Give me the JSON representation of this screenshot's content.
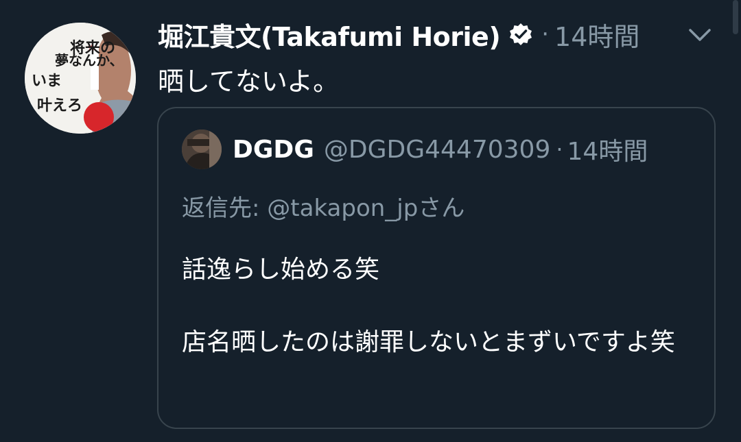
{
  "tweet": {
    "author_name": "堀江貴文(Takafumi Horie)",
    "separator": "·",
    "timestamp": "14時間",
    "text": "晒してないよ。",
    "avatar_icon": "profile-avatar-book-cover",
    "avatar_text": [
      "将来の",
      "夢なんか、",
      "いま",
      "叶えろ"
    ],
    "verified_icon": "verified-badge-icon",
    "menu_icon": "chevron-down-icon"
  },
  "quote": {
    "name": "DGDG",
    "handle": "@DGDG44470309",
    "separator": "·",
    "timestamp": "14時間",
    "reply_label": "返信先:",
    "reply_handle": "@takapon_jpさん",
    "body_line1": "話逸らし始める笑",
    "body_line2": "店名晒したのは謝罪しないとまずいですよ笑",
    "avatar_icon": "profile-avatar-photo"
  },
  "colors": {
    "background": "#15202b",
    "text_primary": "#ffffff",
    "text_secondary": "#8899a6",
    "border": "#38444d"
  }
}
